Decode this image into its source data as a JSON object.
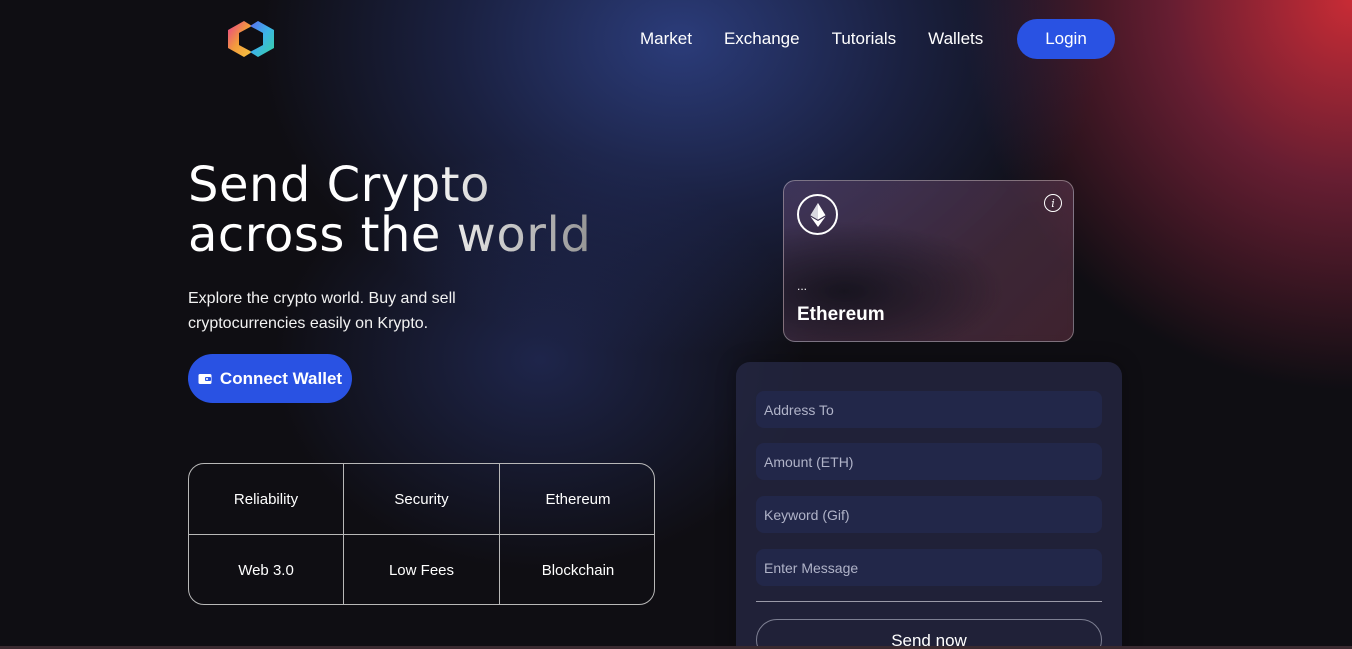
{
  "nav": {
    "links": [
      "Market",
      "Exchange",
      "Tutorials",
      "Wallets"
    ],
    "login_label": "Login"
  },
  "hero": {
    "title_line1": "Send Crypto",
    "title_line2": "across the world",
    "subtitle": "Explore the crypto world. Buy and sell cryptocurrencies easily on Krypto.",
    "connect_label": "Connect Wallet"
  },
  "features": [
    "Reliability",
    "Security",
    "Ethereum",
    "Web 3.0",
    "Low Fees",
    "Blockchain"
  ],
  "eth_card": {
    "address": "...",
    "name": "Ethereum"
  },
  "form": {
    "address_placeholder": "Address To",
    "amount_placeholder": "Amount (ETH)",
    "keyword_placeholder": "Keyword (Gif)",
    "message_placeholder": "Enter Message",
    "send_label": "Send now"
  },
  "colors": {
    "accent": "#2952e3",
    "background": "#0f0e13"
  },
  "icons": [
    "logo-icon",
    "wallet-icon",
    "ethereum-icon",
    "info-icon"
  ]
}
